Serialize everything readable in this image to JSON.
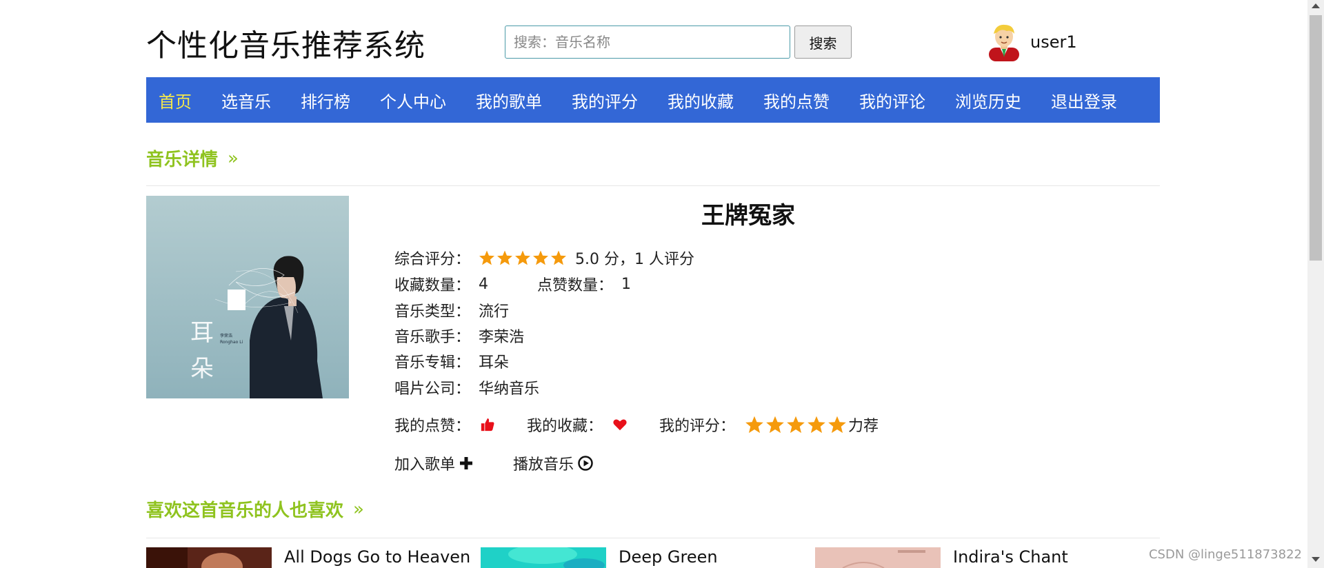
{
  "header": {
    "site_title": "个性化音乐推荐系统",
    "search_placeholder": "搜索：音乐名称",
    "search_button": "搜索",
    "username": "user1"
  },
  "nav": {
    "items": [
      "首页",
      "选音乐",
      "排行榜",
      "个人中心",
      "我的歌单",
      "我的评分",
      "我的收藏",
      "我的点赞",
      "我的评论",
      "浏览历史",
      "退出登录"
    ],
    "active_index": 0
  },
  "detail_section": {
    "heading": "音乐详情",
    "chevron": "»"
  },
  "song": {
    "title": "王牌冤家",
    "rating_label": "综合评分：",
    "rating_stars": 5,
    "rating_text": "5.0 分，1 人评分",
    "collect_label": "收藏数量：",
    "collect_count": "4",
    "like_label": "点赞数量：",
    "like_count": "1",
    "type_label": "音乐类型：",
    "type_value": "流行",
    "singer_label": "音乐歌手：",
    "singer_value": "李荣浩",
    "album_label": "音乐专辑：",
    "album_value": "耳朵",
    "company_label": "唱片公司：",
    "company_value": "华纳音乐",
    "cover": {
      "title_text": "耳朵",
      "artist_cn": "李荣浩",
      "artist_en": "Ronghao Li"
    }
  },
  "actions": {
    "my_like_label": "我的点赞：",
    "my_like_icon": "thumbs-up-icon",
    "my_collect_label": "我的收藏：",
    "my_collect_icon": "heart-icon",
    "my_rating_label": "我的评分：",
    "my_rating_stars": 5,
    "my_rating_text": "力荐",
    "add_playlist_label": "加入歌单",
    "add_playlist_icon": "plus-icon",
    "play_label": "播放音乐",
    "play_icon": "play-circle-icon"
  },
  "recommend_section": {
    "heading": "喜欢这首音乐的人也喜欢",
    "chevron": "»",
    "items": [
      {
        "name": "All Dogs Go to Heaven"
      },
      {
        "name": "Deep Green"
      },
      {
        "name": "Indira's Chant"
      }
    ]
  },
  "colors": {
    "nav_bg": "#3367d6",
    "nav_active": "#f4e84b",
    "section_heading": "#8fc31f",
    "star": "#f59a0c",
    "heart": "#e8101a",
    "thumb": "#e8101a"
  },
  "watermark": "CSDN @linge511873822"
}
